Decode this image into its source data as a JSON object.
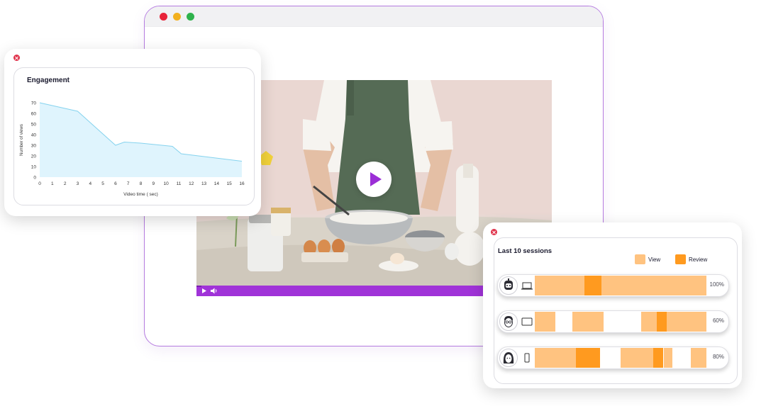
{
  "browser": {
    "dots": [
      "#e8243a",
      "#f2b01e",
      "#2fb24c"
    ]
  },
  "video": {
    "progress": 0.014,
    "play_icon": "play-icon",
    "controls": [
      "play-icon",
      "volume-icon"
    ],
    "accent": "#a033d8"
  },
  "engagement": {
    "title": "Engagement",
    "chart_data": {
      "type": "area",
      "title": "Engagement",
      "xlabel": "Video time ( sec)",
      "ylabel": "Number of views",
      "x_ticks": [
        "0",
        "1",
        "2",
        "3",
        "4",
        "5",
        "6",
        "7",
        "8",
        "9",
        "10",
        "11",
        "12",
        "13",
        "14",
        "15",
        "16"
      ],
      "y_ticks": [
        "0",
        "10",
        "20",
        "30",
        "40",
        "50",
        "60",
        "70"
      ],
      "xlim": [
        0,
        16
      ],
      "ylim": [
        0,
        70
      ],
      "x": [
        0,
        3,
        6,
        6.7,
        8,
        10.5,
        11.2,
        16
      ],
      "y": [
        70,
        62,
        30,
        33,
        32,
        29,
        22,
        15
      ],
      "fill_color": "#dff4fd",
      "line_color": "#86d3ee"
    }
  },
  "sessions": {
    "title": "Last 10 sessions",
    "legend": [
      {
        "label": "View",
        "color": "#ffc380"
      },
      {
        "label": "Review",
        "color": "#ff9a1f"
      }
    ],
    "rows": [
      {
        "avatar": "person-robot-avatar-icon",
        "device": "laptop-icon",
        "percent": "100%",
        "segments": [
          {
            "start": 0.0,
            "end": 0.29,
            "kind": "view"
          },
          {
            "start": 0.29,
            "end": 0.39,
            "kind": "review"
          },
          {
            "start": 0.39,
            "end": 1.0,
            "kind": "view"
          }
        ]
      },
      {
        "avatar": "person-glasses-avatar-icon",
        "device": "tablet-icon",
        "percent": "60%",
        "segments": [
          {
            "start": 0.0,
            "end": 0.12,
            "kind": "view"
          },
          {
            "start": 0.22,
            "end": 0.4,
            "kind": "view"
          },
          {
            "start": 0.62,
            "end": 0.71,
            "kind": "view"
          },
          {
            "start": 0.71,
            "end": 0.77,
            "kind": "review"
          },
          {
            "start": 0.77,
            "end": 1.0,
            "kind": "view"
          }
        ]
      },
      {
        "avatar": "person-long-hair-avatar-icon",
        "device": "phone-icon",
        "percent": "80%",
        "segments": [
          {
            "start": 0.0,
            "end": 0.24,
            "kind": "view"
          },
          {
            "start": 0.24,
            "end": 0.38,
            "kind": "review"
          },
          {
            "start": 0.5,
            "end": 0.69,
            "kind": "view"
          },
          {
            "start": 0.69,
            "end": 0.75,
            "kind": "review"
          },
          {
            "start": 0.75,
            "end": 0.8,
            "kind": "view"
          },
          {
            "start": 0.91,
            "end": 1.0,
            "kind": "view"
          }
        ]
      }
    ]
  }
}
